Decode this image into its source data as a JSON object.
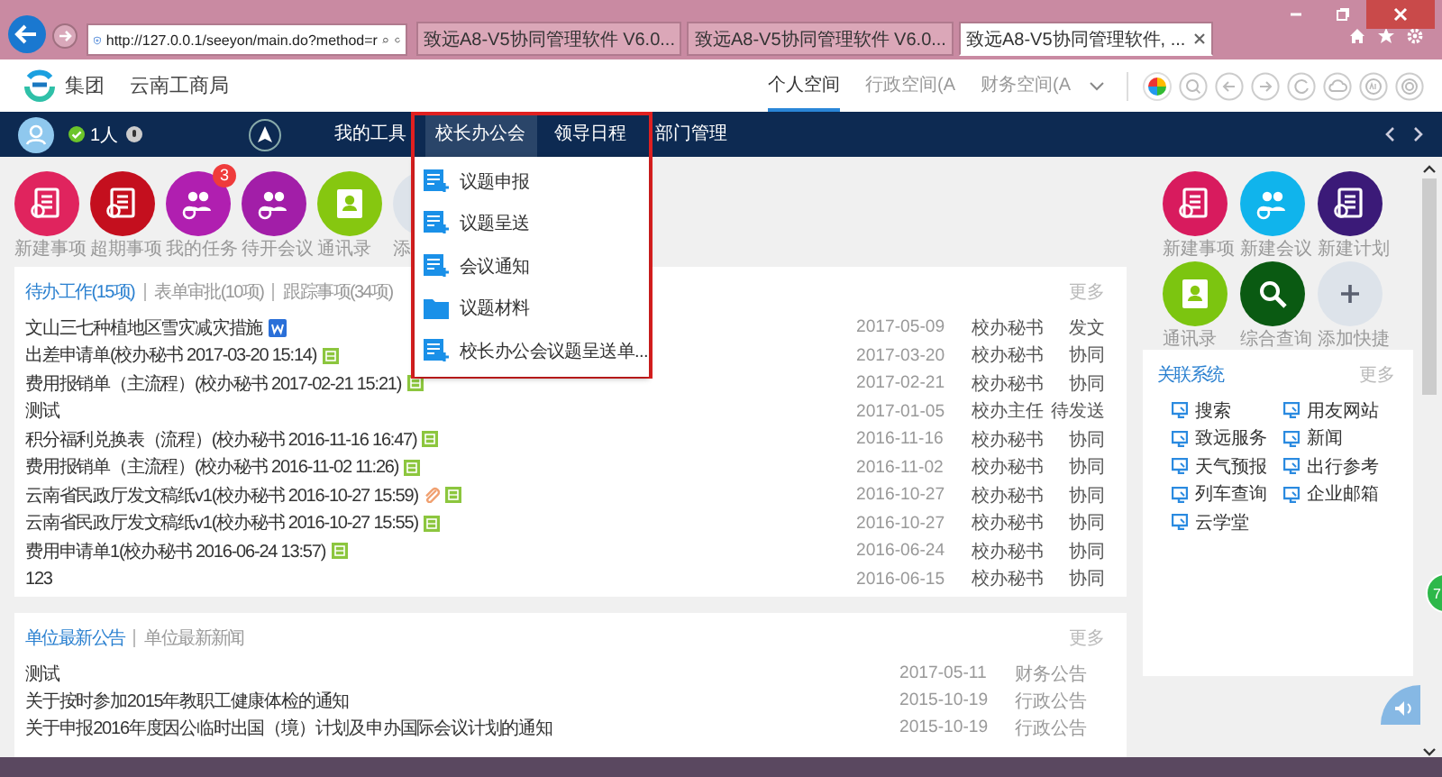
{
  "browser": {
    "address": "http://127.0.0.1/seeyon/main.do?method=r",
    "tabs": [
      {
        "title": "致远A8-V5协同管理软件 V6.0...",
        "selected": false
      },
      {
        "title": "致远A8-V5协同管理软件 V6.0...",
        "selected": false
      },
      {
        "title": "致远A8-V5协同管理软件, ...",
        "selected": true
      }
    ]
  },
  "header": {
    "org": "集团",
    "unit": "云南工商局",
    "spaces": [
      {
        "label": "个人空间",
        "selected": true
      },
      {
        "label": "行政空间(A",
        "selected": false
      },
      {
        "label": "财务空间(A",
        "selected": false
      }
    ]
  },
  "nav": {
    "online": "1人",
    "items": [
      {
        "label": "我的工具",
        "selected": false
      },
      {
        "label": "校长办公会",
        "selected": true
      },
      {
        "label": "领导日程",
        "selected": false
      },
      {
        "label": "部门管理",
        "selected": false
      }
    ],
    "menu": [
      {
        "label": "议题申报",
        "kind": "form"
      },
      {
        "label": "议题呈送",
        "kind": "form"
      },
      {
        "label": "会议通知",
        "kind": "form"
      },
      {
        "label": "议题材料",
        "kind": "folder"
      },
      {
        "label": "校长办公会议题呈送单...",
        "kind": "form"
      }
    ]
  },
  "quick_left": [
    {
      "label": "新建事项",
      "color": "#e0245e",
      "kind": "doc"
    },
    {
      "label": "超期事项",
      "color": "#c40f1e",
      "kind": "doc"
    },
    {
      "label": "我的任务",
      "color": "#b01fb0",
      "kind": "people",
      "badge": "3"
    },
    {
      "label": "待开会议",
      "color": "#a21ea8",
      "kind": "people"
    },
    {
      "label": "通讯录",
      "color": "#86c710",
      "kind": "contact"
    },
    {
      "label": "添",
      "color": "#dde3ea",
      "kind": "plus"
    }
  ],
  "todo": {
    "tabs": [
      {
        "label": "待办工作(15项)",
        "selected": true
      },
      {
        "label": "表单审批(10项)",
        "selected": false
      },
      {
        "label": "跟踪事项(34项)",
        "selected": false
      }
    ],
    "more": "更多",
    "rows": [
      {
        "title": "文山三七种植地区雪灾减灾措施",
        "word_icon": true,
        "attachment": false,
        "form_icon": false,
        "date": "2017-05-09",
        "sender": "校办秘书",
        "type": "发文"
      },
      {
        "title": "出差申请单(校办秘书 2017-03-20 15:14)",
        "word_icon": false,
        "attachment": false,
        "form_icon": true,
        "date": "2017-03-20",
        "sender": "校办秘书",
        "type": "协同"
      },
      {
        "title": "费用报销单（主流程）(校办秘书 2017-02-21 15:21)",
        "word_icon": false,
        "attachment": false,
        "form_icon": true,
        "date": "2017-02-21",
        "sender": "校办秘书",
        "type": "协同"
      },
      {
        "title": "测试",
        "word_icon": false,
        "attachment": false,
        "form_icon": false,
        "date": "2017-01-05",
        "sender": "校办主任",
        "type": "待发送"
      },
      {
        "title": "积分福利兑换表（流程）(校办秘书 2016-11-16 16:47)",
        "word_icon": false,
        "attachment": false,
        "form_icon": true,
        "date": "2016-11-16",
        "sender": "校办秘书",
        "type": "协同"
      },
      {
        "title": "费用报销单（主流程）(校办秘书 2016-11-02 11:26)",
        "word_icon": false,
        "attachment": false,
        "form_icon": true,
        "date": "2016-11-02",
        "sender": "校办秘书",
        "type": "协同"
      },
      {
        "title": "云南省民政厅发文稿纸v1(校办秘书 2016-10-27 15:59)",
        "word_icon": false,
        "attachment": true,
        "form_icon": true,
        "date": "2016-10-27",
        "sender": "校办秘书",
        "type": "协同"
      },
      {
        "title": "云南省民政厅发文稿纸v1(校办秘书 2016-10-27 15:55)",
        "word_icon": false,
        "attachment": false,
        "form_icon": true,
        "date": "2016-10-27",
        "sender": "校办秘书",
        "type": "协同"
      },
      {
        "title": "费用申请单1(校办秘书 2016-06-24 13:57)",
        "word_icon": false,
        "attachment": false,
        "form_icon": true,
        "date": "2016-06-24",
        "sender": "校办秘书",
        "type": "协同"
      },
      {
        "title": "123",
        "word_icon": false,
        "attachment": false,
        "form_icon": false,
        "date": "2016-06-15",
        "sender": "校办秘书",
        "type": "协同"
      }
    ]
  },
  "notices": {
    "tabs": [
      {
        "label": "单位最新公告",
        "selected": true
      },
      {
        "label": "单位最新新闻",
        "selected": false
      }
    ],
    "more": "更多",
    "rows": [
      {
        "title": "测试",
        "date": "2017-05-11",
        "category": "财务公告"
      },
      {
        "title": "关于按时参加2015年教职工健康体检的通知",
        "date": "2015-10-19",
        "category": "行政公告"
      },
      {
        "title": "关于申报2016年度因公临时出国（境）计划及申办国际会议计划的通知",
        "date": "2015-10-19",
        "category": "行政公告"
      }
    ]
  },
  "quick_right": [
    {
      "label": "新建事项",
      "color": "#d81b5e",
      "kind": "doc"
    },
    {
      "label": "新建会议",
      "color": "#10b4ec",
      "kind": "people"
    },
    {
      "label": "新建计划",
      "color": "#3b1a78",
      "kind": "doc"
    },
    {
      "label": "通讯录",
      "color": "#7cc510",
      "kind": "contact"
    },
    {
      "label": "综合查询",
      "color": "#0a5a12",
      "kind": "search"
    },
    {
      "label": "添加快捷",
      "color": "#dde3ea",
      "kind": "plus"
    }
  ],
  "related": {
    "title": "关联系统",
    "more": "更多",
    "items": [
      "搜索",
      "用友网站",
      "致远服务",
      "新闻",
      "天气预报",
      "出行参考",
      "列车查询",
      "企业邮箱",
      "云学堂"
    ]
  },
  "float_badge": "7"
}
